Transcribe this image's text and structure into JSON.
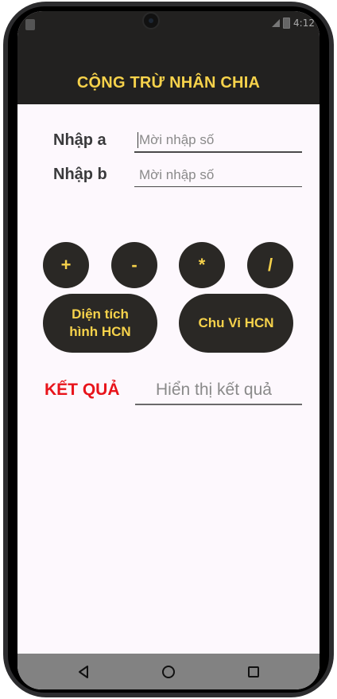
{
  "status": {
    "time": "4:12"
  },
  "app": {
    "title": "CỘNG TRỪ NHÂN CHIA"
  },
  "form": {
    "label_a": "Nhập a",
    "label_b": "Nhập b",
    "placeholder_a": "Mời nhập số",
    "placeholder_b": "Mời nhập số",
    "value_a": "",
    "value_b": ""
  },
  "buttons": {
    "add": "+",
    "subtract": "-",
    "multiply": "*",
    "divide": "/",
    "area_line1": "Diện tích",
    "area_line2": "hình HCN",
    "perimeter": "Chu Vi HCN"
  },
  "result": {
    "label": "KẾT QUẢ",
    "placeholder": "Hiển thị kết quả"
  },
  "colors": {
    "accent_yellow": "#f6d24b",
    "button_dark": "#2a2825",
    "result_red": "#e8141b",
    "appbar_dark": "#222120",
    "background": "#fdf8fd"
  },
  "navbar": {
    "back_icon": "back-triangle-icon",
    "home_icon": "home-circle-icon",
    "recents_icon": "recents-square-icon"
  }
}
